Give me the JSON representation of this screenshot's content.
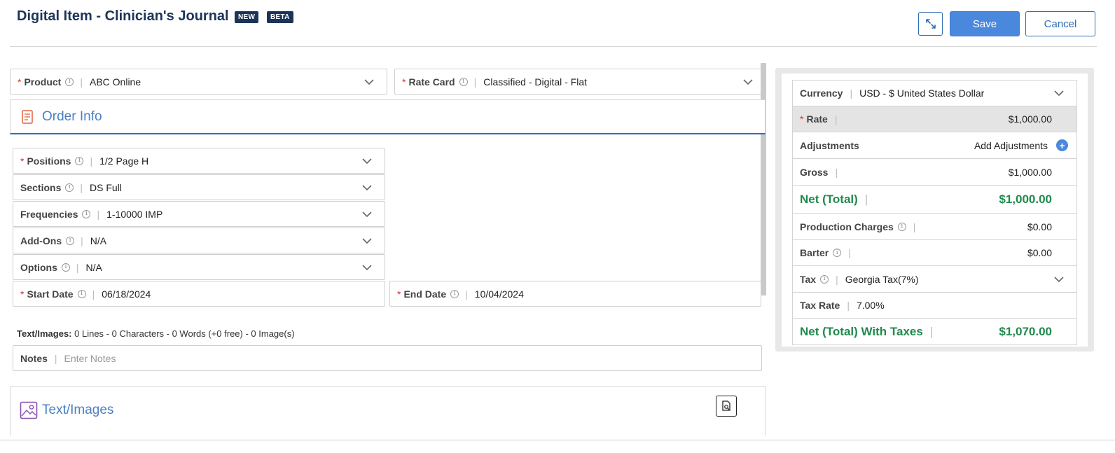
{
  "header": {
    "title": "Digital Item - Clinician's Journal",
    "badge_new": "NEW",
    "badge_beta": "BETA",
    "save_label": "Save",
    "cancel_label": "Cancel"
  },
  "product": {
    "label": "Product",
    "value": "ABC Online"
  },
  "rate_card": {
    "label": "Rate Card",
    "value": "Classified - Digital - Flat"
  },
  "order_info": {
    "title": "Order Info",
    "positions": {
      "label": "Positions",
      "value": "1/2 Page H"
    },
    "sections": {
      "label": "Sections",
      "value": "DS Full"
    },
    "frequencies": {
      "label": "Frequencies",
      "value": "1-10000 IMP"
    },
    "addons": {
      "label": "Add-Ons",
      "value": "N/A"
    },
    "options": {
      "label": "Options",
      "value": "N/A"
    },
    "start_date": {
      "label": "Start Date",
      "value": "06/18/2024"
    },
    "end_date": {
      "label": "End Date",
      "value": "10/04/2024"
    },
    "text_images_label": "Text/Images:",
    "text_images_summary": "0 Lines - 0 Characters - 0 Words (+0 free) - 0 Image(s)",
    "notes_label": "Notes",
    "notes_placeholder": "Enter Notes"
  },
  "text_images_section": {
    "title": "Text/Images"
  },
  "pricing": {
    "currency": {
      "label": "Currency",
      "value": "USD - $ United States Dollar"
    },
    "rate": {
      "label": "Rate",
      "value": "$1,000.00"
    },
    "adjustments": {
      "label": "Adjustments",
      "action": "Add Adjustments"
    },
    "gross": {
      "label": "Gross",
      "value": "$1,000.00"
    },
    "net_total": {
      "label": "Net (Total)",
      "value": "$1,000.00"
    },
    "production_charges": {
      "label": "Production Charges",
      "value": "$0.00"
    },
    "barter": {
      "label": "Barter",
      "value": "$0.00"
    },
    "tax": {
      "label": "Tax",
      "value": "Georgia Tax(7%)"
    },
    "tax_rate": {
      "label": "Tax Rate",
      "value": "7.00%"
    },
    "net_with_taxes": {
      "label": "Net (Total) With Taxes",
      "value": "$1,070.00"
    }
  },
  "colors": {
    "primary": "#4a88de",
    "title": "#1c3557",
    "section": "#4a7fc1",
    "green": "#1f8a4c",
    "required": "#dd3333"
  }
}
